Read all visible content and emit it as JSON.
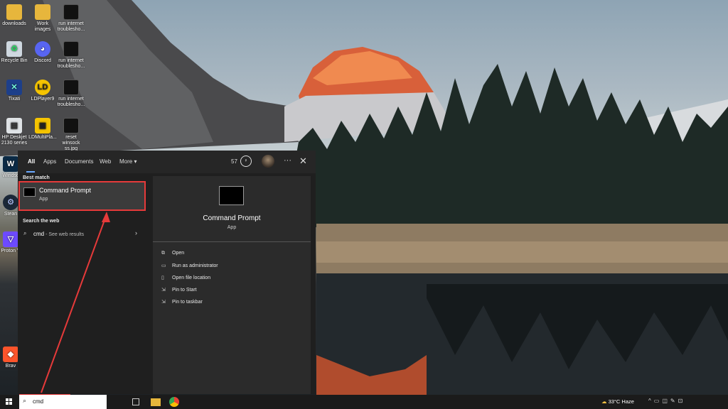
{
  "desktop": {
    "icons": [
      {
        "label": "downloads"
      },
      {
        "label": "Work images"
      },
      {
        "label": "run internet troublesho..."
      },
      {
        "label": "Recycle Bin"
      },
      {
        "label": "Discord"
      },
      {
        "label": "run internet troublesho..."
      },
      {
        "label": "Tixati"
      },
      {
        "label": "LDPlayer9"
      },
      {
        "label": "run internet troublesho..."
      },
      {
        "label": "HP Deskjet 2130 series"
      },
      {
        "label": "LDMultiPla..."
      },
      {
        "label": "reset winsock ss.jpg"
      },
      {
        "label": "Windsc"
      },
      {
        "label": "Stean"
      },
      {
        "label": "Proton V"
      },
      {
        "label": "Brav"
      }
    ]
  },
  "search_panel": {
    "tabs": [
      {
        "label": "All"
      },
      {
        "label": "Apps"
      },
      {
        "label": "Documents"
      },
      {
        "label": "Web"
      },
      {
        "label": "More ▾"
      }
    ],
    "points": "57",
    "best_match_label": "Best match",
    "best_match": {
      "title": "Command Prompt",
      "subtitle": "App"
    },
    "web_label": "Search the web",
    "web_item": {
      "query": "cmd",
      "suffix": " - See web results"
    },
    "detail": {
      "title": "Command Prompt",
      "subtitle": "App",
      "actions": [
        {
          "label": "Open"
        },
        {
          "label": "Run as administrator"
        },
        {
          "label": "Open file location"
        },
        {
          "label": "Pin to Start"
        },
        {
          "label": "Pin to taskbar"
        }
      ]
    }
  },
  "taskbar": {
    "search_value": "cmd",
    "weather": "33°C  Haze"
  },
  "colors": {
    "highlight": "#e63a3a",
    "accent": "#6aa8ff"
  }
}
